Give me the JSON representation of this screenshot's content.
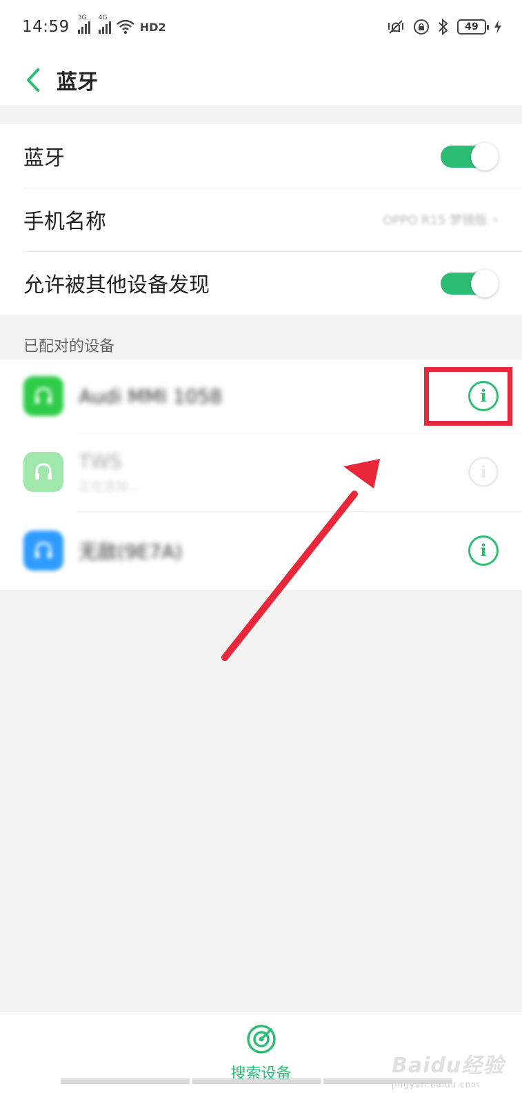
{
  "status_bar": {
    "time": "14:59",
    "network_1": "3G",
    "network_2": "4G",
    "hd_label": "HD2",
    "battery": "49"
  },
  "app_bar": {
    "title": "蓝牙"
  },
  "settings": {
    "bluetooth_label": "蓝牙",
    "bluetooth_on": true,
    "phone_name_label": "手机名称",
    "phone_name_value": "OPPO R15 梦镜版",
    "discoverable_label": "允许被其他设备发现",
    "discoverable_on": true
  },
  "paired_section": {
    "header": "已配对的设备",
    "devices": [
      {
        "name": "Audi MMI 1058",
        "subtitle": "",
        "icon": "headset-icon",
        "color": "#2fcc4a",
        "connected": false
      },
      {
        "name": "TWS",
        "subtitle": "正在连接...",
        "icon": "headset-icon",
        "color": "#2fcc4a",
        "connected": true
      },
      {
        "name": "无敌(9E7A)",
        "subtitle": "",
        "icon": "headset-icon",
        "color": "#2e9bff",
        "connected": false
      }
    ]
  },
  "bottom": {
    "scan_label": "搜索设备",
    "watermark": "Baidu经验",
    "watermark_url": "jingyan.baidu.com"
  },
  "colors": {
    "accent": "#2dbd75",
    "annotation": "#e8283a"
  }
}
